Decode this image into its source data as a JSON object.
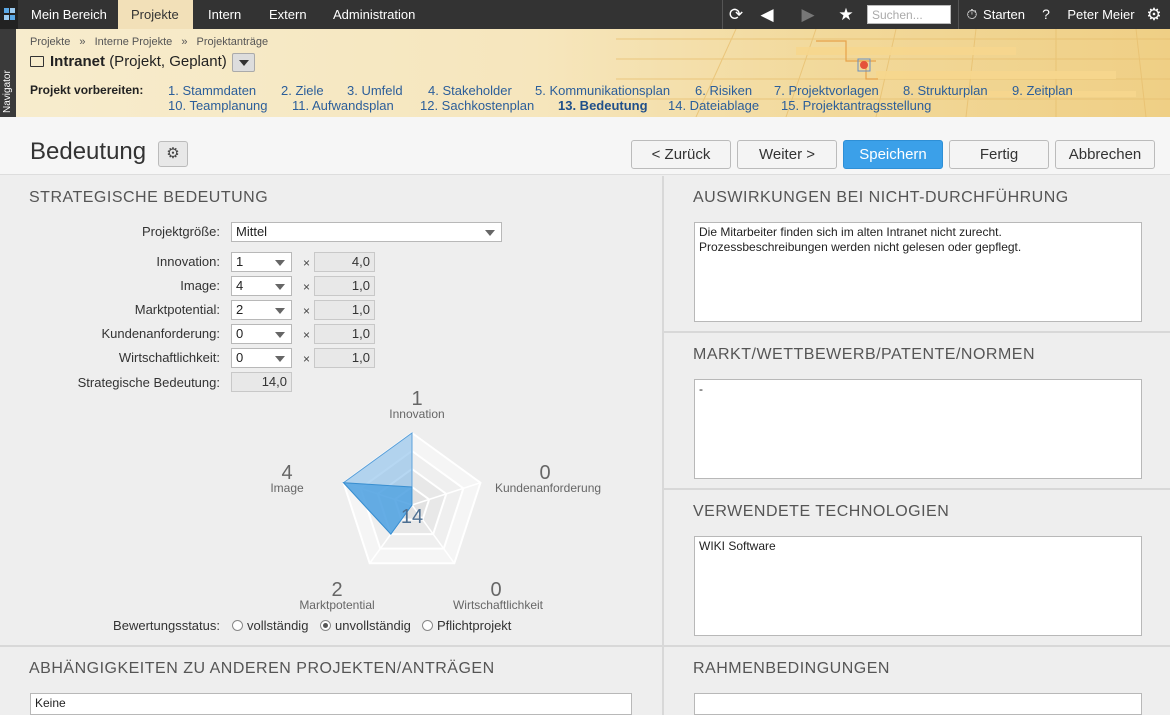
{
  "topbar": {
    "menu": [
      "Mein Bereich",
      "Projekte",
      "Intern",
      "Extern",
      "Administration"
    ],
    "active_menu": "Projekte",
    "search_placeholder": "Suchen...",
    "start_label": "Starten",
    "help_label": "?",
    "user_name": "Peter Meier"
  },
  "navigator_label": "Navigator",
  "header": {
    "breadcrumb": [
      "Projekte",
      "»",
      "Interne Projekte",
      "»",
      "Projektanträge"
    ],
    "project_name": "Intranet",
    "project_meta": "(Projekt, Geplant)",
    "steps_label": "Projekt vorbereiten:",
    "steps": [
      "1. Stammdaten",
      "2. Ziele",
      "3. Umfeld",
      "4. Stakeholder",
      "5. Kommunikationsplan",
      "6. Risiken",
      "7. Projektvorlagen",
      "8. Strukturplan",
      "9. Zeitplan",
      "10. Teamplanung",
      "11. Aufwandsplan",
      "12. Sachkostenplan",
      "13. Bedeutung",
      "14. Dateiablage",
      "15. Projektantragsstellung"
    ],
    "current_step": "13. Bedeutung"
  },
  "toolbar": {
    "title": "Bedeutung",
    "back_label": "< Zurück",
    "next_label": "Weiter >",
    "save_label": "Speichern",
    "done_label": "Fertig",
    "cancel_label": "Abbrechen"
  },
  "strategic": {
    "title": "STRATEGISCHE BEDEUTUNG",
    "size_label": "Projektgröße:",
    "size_value": "Mittel",
    "criteria": [
      {
        "label": "Innovation:",
        "value": "1",
        "weight": "4,0"
      },
      {
        "label": "Image:",
        "value": "4",
        "weight": "1,0"
      },
      {
        "label": "Marktpotential:",
        "value": "2",
        "weight": "1,0"
      },
      {
        "label": "Kundenanforderung:",
        "value": "0",
        "weight": "1,0"
      },
      {
        "label": "Wirtschaftlichkeit:",
        "value": "0",
        "weight": "1,0"
      }
    ],
    "times_sign": "×",
    "total_label": "Strategische Bedeutung:",
    "total_value": "14,0",
    "status_label": "Bewertungsstatus:",
    "status_options": [
      "vollständig",
      "unvollständig",
      "Pflichtprojekt"
    ],
    "status_selected": "unvollständig"
  },
  "chart_data": {
    "type": "radar",
    "axes": [
      "Innovation",
      "Kundenanforderung",
      "Wirtschaftlichkeit",
      "Marktpotential",
      "Image"
    ],
    "values": [
      1,
      0,
      0,
      2,
      4
    ],
    "value_labels": [
      "1",
      "0",
      "0",
      "2",
      "4"
    ],
    "weighted_values": [
      4,
      0,
      0,
      2,
      4
    ],
    "max": 4,
    "center_label": "14",
    "colors": {
      "weighted": "#7ab6e8",
      "raw": "#4a9fe0"
    }
  },
  "right_sections": [
    {
      "title": "AUSWIRKUNGEN BEI NICHT-DURCHFÜHRUNG",
      "text": "Die Mitarbeiter finden sich im alten Intranet nicht zurecht.\nProzessbeschreibungen werden nicht gelesen oder gepflegt."
    },
    {
      "title": "MARKT/WETTBEWERB/PATENTE/NORMEN",
      "text": "-"
    },
    {
      "title": "VERWENDETE TECHNOLOGIEN",
      "text": "WIKI Software"
    },
    {
      "title": "RAHMENBEDINGUNGEN",
      "text": ""
    }
  ],
  "dependencies": {
    "title": "ABHÄNGIGKEITEN ZU ANDEREN PROJEKTEN/ANTRÄGEN",
    "text": "Keine"
  }
}
